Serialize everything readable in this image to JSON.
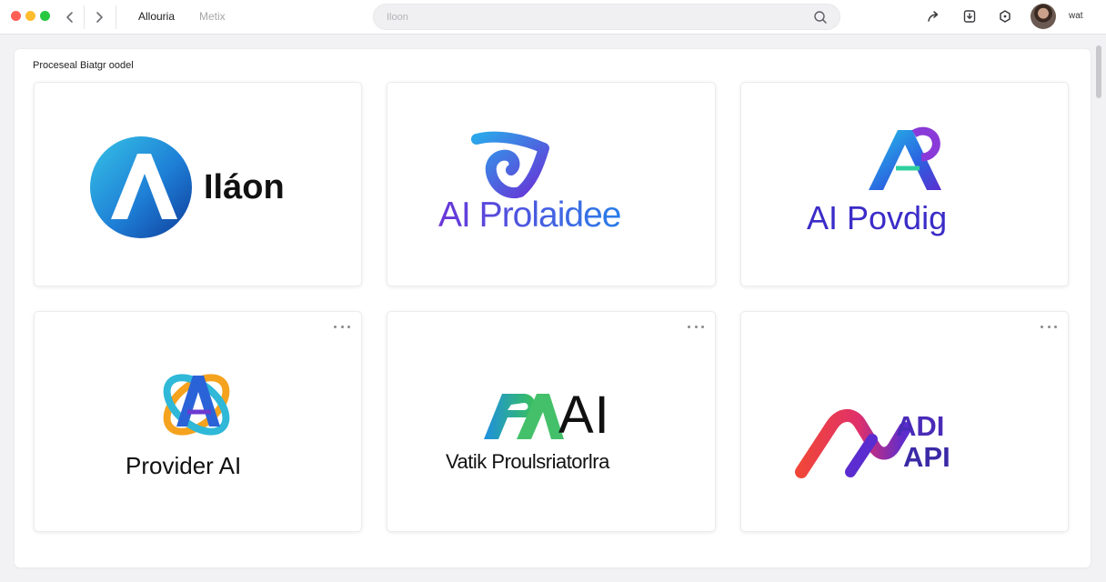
{
  "toolbar": {
    "tabs": [
      {
        "label": "Allouria",
        "active": true
      },
      {
        "label": "Metix",
        "active": false
      }
    ],
    "search": {
      "placeholder": "Iloon",
      "value": ""
    },
    "user": {
      "name": "wat"
    },
    "icons": [
      "back-arrow-icon",
      "forward-arrow-icon",
      "search-icon",
      "share-icon",
      "download-icon",
      "notification-icon"
    ]
  },
  "panel": {
    "title": "Proceseal Biatgr oodel",
    "cards": [
      {
        "brand_text": "Iláon",
        "logo": "blue-a-circle-logo",
        "has_menu": false
      },
      {
        "brand_text": "AI Prolaidee",
        "logo": "blue-purple-swirl-logo",
        "has_menu": false
      },
      {
        "brand_text": "AI Povdig",
        "logo": "gradient-a-logo",
        "has_menu": false
      },
      {
        "brand_text": "Provider AI",
        "logo": "orbit-a-logo",
        "has_menu": true
      },
      {
        "brand_text_main": "AI",
        "brand_text_sub": "Vatik Proulsriatorlra",
        "logo": "green-blue-pa-logo",
        "has_menu": true
      },
      {
        "brand_text_top": "ADI",
        "brand_text_bottom": "API",
        "logo": "red-purple-wave-logo",
        "has_menu": true
      }
    ]
  },
  "colors": {
    "accent_blue": "#1e6fe0",
    "accent_purple": "#5b2ccf",
    "accent_green": "#45c06a",
    "accent_red": "#f0463a"
  }
}
